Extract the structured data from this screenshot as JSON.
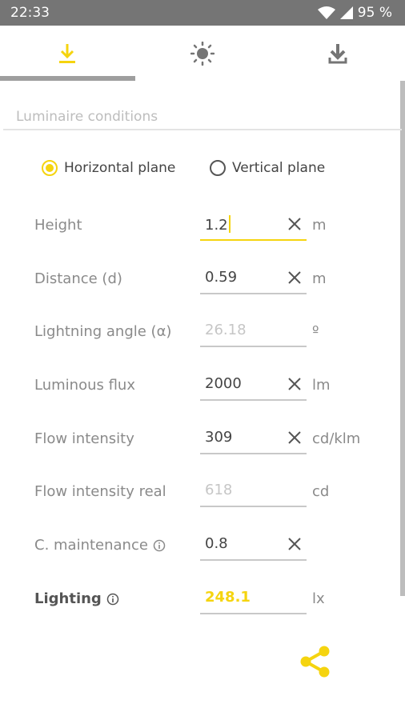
{
  "status_bar": {
    "time": "22:33",
    "battery": "95 %"
  },
  "tabs": [
    {
      "name": "tab-luminaire",
      "icon": "download-arrow-icon",
      "active": true
    },
    {
      "name": "tab-light",
      "icon": "sun-icon",
      "active": false
    },
    {
      "name": "tab-download",
      "icon": "download-icon",
      "active": false
    }
  ],
  "section": {
    "title": "Luminaire conditions"
  },
  "radios": {
    "horizontal": "Horizontal plane",
    "vertical": "Vertical plane"
  },
  "fields": {
    "height": {
      "label": "Height",
      "value": "1.2",
      "unit": "m"
    },
    "distance": {
      "label": "Distance (d)",
      "value": "0.59",
      "unit": "m"
    },
    "angle": {
      "label": "Lightning angle (α)",
      "value": "26.18",
      "unit": "º"
    },
    "flux": {
      "label": "Luminous flux",
      "value": "2000",
      "unit": "lm"
    },
    "intensity": {
      "label": "Flow intensity",
      "value": "309",
      "unit": "cd/klm"
    },
    "intensity_real": {
      "label": "Flow intensity real",
      "value": "618",
      "unit": "cd"
    },
    "maintenance": {
      "label": "C. maintenance",
      "value": "0.8",
      "unit": ""
    },
    "lighting": {
      "label": "Lighting",
      "value": "248.1",
      "unit": "lx"
    }
  },
  "colors": {
    "accent": "#f5d40f",
    "status_bar": "#757575"
  }
}
